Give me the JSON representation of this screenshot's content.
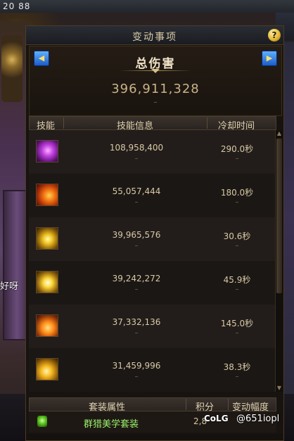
{
  "background": {
    "top_numbers": "20  88",
    "chat_text": "好呀"
  },
  "panel": {
    "title": "变动事项",
    "help_label": "?",
    "prev_label": "◀",
    "next_label": "▶",
    "damage_label": "总伤害",
    "damage_total": "396,911,328",
    "damage_change": "–"
  },
  "columns": {
    "skill": "技能",
    "info": "技能信息",
    "cooldown": "冷却时间"
  },
  "skills": [
    {
      "icon": "purple-demon-skill-icon",
      "damage": "108,958,400",
      "change": "–",
      "cooldown": "290.0秒",
      "cooldown_change": "–"
    },
    {
      "icon": "fire-beast-skill-icon",
      "damage": "55,057,444",
      "change": "–",
      "cooldown": "180.0秒",
      "cooldown_change": "–"
    },
    {
      "icon": "lightning-burst-skill-icon",
      "damage": "39,965,576",
      "change": "–",
      "cooldown": "30.6秒",
      "cooldown_change": "–"
    },
    {
      "icon": "star-burst-skill-icon",
      "damage": "39,242,272",
      "change": "–",
      "cooldown": "45.9秒",
      "cooldown_change": "–"
    },
    {
      "icon": "flame-claw-skill-icon",
      "damage": "37,332,136",
      "change": "–",
      "cooldown": "145.0秒",
      "cooldown_change": "–"
    },
    {
      "icon": "golden-slash-skill-icon",
      "damage": "31,459,996",
      "change": "–",
      "cooldown": "38.3秒",
      "cooldown_change": "–"
    }
  ],
  "set_section": {
    "col_attr": "套装属性",
    "col_score": "积分",
    "col_change": "变动幅度",
    "set_name": "群猎美学套装",
    "score": "2,8"
  },
  "watermark": {
    "logo": "CoLG",
    "handle": "@651iopl"
  }
}
